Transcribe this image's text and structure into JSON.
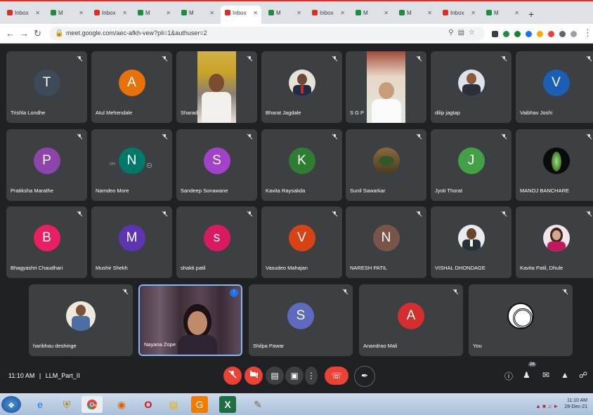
{
  "browser": {
    "tabs": [
      {
        "label": "Inbox",
        "color": "#d93025"
      },
      {
        "label": "M",
        "color": "#1e8e3e"
      },
      {
        "label": "Inbox",
        "color": "#d93025"
      },
      {
        "label": "M",
        "color": "#1e8e3e"
      },
      {
        "label": "M",
        "color": "#1e8e3e"
      },
      {
        "label": "Inbox",
        "color": "#d93025"
      },
      {
        "label": "M",
        "color": "#1e8e3e"
      },
      {
        "label": "Inbox",
        "color": "#d93025"
      },
      {
        "label": "M",
        "color": "#1e8e3e"
      },
      {
        "label": "M",
        "color": "#1e8e3e"
      },
      {
        "label": "Inbox",
        "color": "#d93025"
      },
      {
        "label": "M",
        "color": "#1e8e3e"
      }
    ],
    "active_tab_index": 5,
    "new_tab": "+",
    "url": "meet.google.com/aec-afkh-vew?pli=1&authuser=2"
  },
  "participants": [
    {
      "name": "Trishla Londhe",
      "initial": "T",
      "color": "#3c4a5a"
    },
    {
      "name": "Atul Mehendale",
      "initial": "A",
      "color": "#e8710a"
    },
    {
      "name": "Sharad",
      "initial": "",
      "color": ""
    },
    {
      "name": "Bharat Jagdale",
      "initial": "",
      "color": ""
    },
    {
      "name": "S G P",
      "initial": "",
      "color": ""
    },
    {
      "name": "dilip jagtap",
      "initial": "",
      "color": ""
    },
    {
      "name": "Vaibhav Joshi",
      "initial": "V",
      "color": "#1a5fb4"
    },
    {
      "name": "Pratiksha Marathe",
      "initial": "P",
      "color": "#8e44ad"
    },
    {
      "name": "Namdeo More",
      "initial": "N",
      "color": "#00796b"
    },
    {
      "name": "Sandeep Sonawane",
      "initial": "S",
      "color": "#a142c8"
    },
    {
      "name": "Kavita Raysakda",
      "initial": "K",
      "color": "#2e7d32"
    },
    {
      "name": "Sunil Sawarkar",
      "initial": "",
      "color": ""
    },
    {
      "name": "Jyoti Thorat",
      "initial": "J",
      "color": "#43a047"
    },
    {
      "name": "MANOJ BANCHARE",
      "initial": "",
      "color": ""
    },
    {
      "name": "Bhagyashri Chaudhari",
      "initial": "B",
      "color": "#e91e63"
    },
    {
      "name": "Mushir Shekh",
      "initial": "M",
      "color": "#5e35b1"
    },
    {
      "name": "shakti patil",
      "initial": "s",
      "color": "#d81b60"
    },
    {
      "name": "Vasudeo Mahajan",
      "initial": "V",
      "color": "#d84315"
    },
    {
      "name": "NARESH PATIL",
      "initial": "N",
      "color": "#795548"
    },
    {
      "name": "VISHAL DHONDAGE",
      "initial": "",
      "color": ""
    },
    {
      "name": "Kavita Patil, Dhule",
      "initial": "",
      "color": ""
    },
    {
      "name": "haribhau deshinge",
      "initial": "",
      "color": ""
    },
    {
      "name": "Nayana Zope",
      "initial": "",
      "color": ""
    },
    {
      "name": "Shilpa Pawar",
      "initial": "S",
      "color": "#5c6bc0"
    },
    {
      "name": "Anandrao Mali",
      "initial": "A",
      "color": "#d32f2f"
    },
    {
      "name": "You",
      "initial": "",
      "color": ""
    }
  ],
  "meeting": {
    "time": "11:10 AM",
    "separator": "|",
    "code": "LLM_Part_II",
    "participant_badge": "26"
  },
  "taskbar": {
    "time": "11:10 AM",
    "date": "28-Dec-21"
  }
}
